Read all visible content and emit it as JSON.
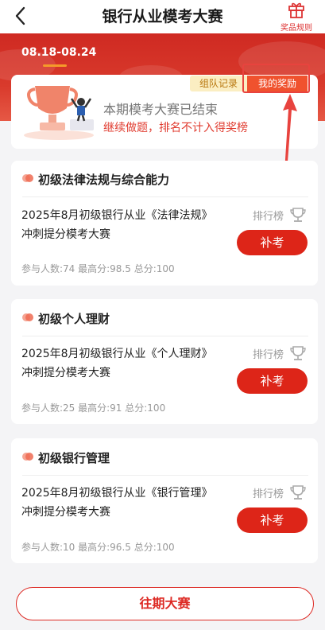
{
  "header": {
    "title": "银行从业模考大赛",
    "rules_label": "奖品规则"
  },
  "period": {
    "date_range": "08.18-08.24"
  },
  "status_card": {
    "team_record_label": "组队记录",
    "my_awards_label": "我的奖励",
    "title": "本期模考大赛已结束",
    "subtitle": "继续做题，排名不计入得奖榜"
  },
  "exams": [
    {
      "category": "初级法律法规与综合能力",
      "name_line1": "2025年8月初级银行从业《法律法规》",
      "name_line2": "冲刺提分模考大赛",
      "rank_label": "排行榜",
      "button_label": "补考",
      "stats": "参与人数:74  最高分:98.5  总分:100"
    },
    {
      "category": "初级个人理财",
      "name_line1": "2025年8月初级银行从业《个人理财》",
      "name_line2": "冲刺提分模考大赛",
      "rank_label": "排行榜",
      "button_label": "补考",
      "stats": "参与人数:25  最高分:91  总分:100"
    },
    {
      "category": "初级银行管理",
      "name_line1": "2025年8月初级银行从业《银行管理》",
      "name_line2": "冲刺提分模考大赛",
      "rank_label": "排行榜",
      "button_label": "补考",
      "stats": "参与人数:10  最高分:96.5  总分:100"
    }
  ],
  "footer": {
    "past_label": "往期大赛"
  },
  "colors": {
    "brand_red": "#dd2518",
    "banner_red": "#cf2a22",
    "tag_gold": "#fbeec2"
  }
}
